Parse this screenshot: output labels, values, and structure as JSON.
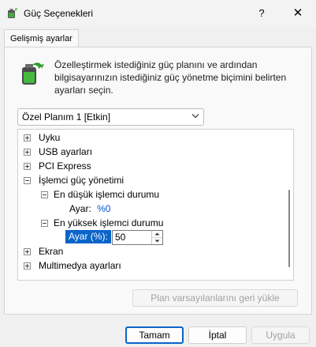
{
  "window": {
    "title": "Güç Seçenekleri",
    "help_label": "?",
    "close_label": "✕"
  },
  "tab": {
    "label": "Gelişmiş ayarlar"
  },
  "intro_text": "Özelleştirmek istediğiniz güç planını ve ardından bilgisayarınızın istediğiniz güç yönetme biçimini belirten ayarları seçin.",
  "plan_dropdown": {
    "selected": "Özel Planım 1 [Etkin]"
  },
  "tree": {
    "items": [
      {
        "label": "Uyku",
        "expander": "+"
      },
      {
        "label": "USB ayarları",
        "expander": "+"
      },
      {
        "label": "PCI Express",
        "expander": "+"
      },
      {
        "label": "İşlemci güç yönetimi",
        "expander": "-"
      },
      {
        "label": "En düşük işlemci durumu",
        "expander": "-"
      },
      {
        "label": "Ayar:",
        "value": "%0"
      },
      {
        "label": "En yüksek işlemci durumu",
        "expander": "-"
      },
      {
        "label": "Ayar (%):",
        "value": "50"
      },
      {
        "label": "Ekran",
        "expander": "+"
      },
      {
        "label": "Multimedya ayarları",
        "expander": "+"
      }
    ]
  },
  "buttons": {
    "restore": "Plan varsayılanlarını geri yükle",
    "ok": "Tamam",
    "cancel": "İptal",
    "apply": "Uygula"
  },
  "colors": {
    "accent": "#0a64c8",
    "value_blue": "#0055cc",
    "disabled_text": "#a2a2a2"
  },
  "icons": {
    "app": "battery-power-icon",
    "intro": "battery-power-icon",
    "dropdown": "chevron-down-icon"
  }
}
